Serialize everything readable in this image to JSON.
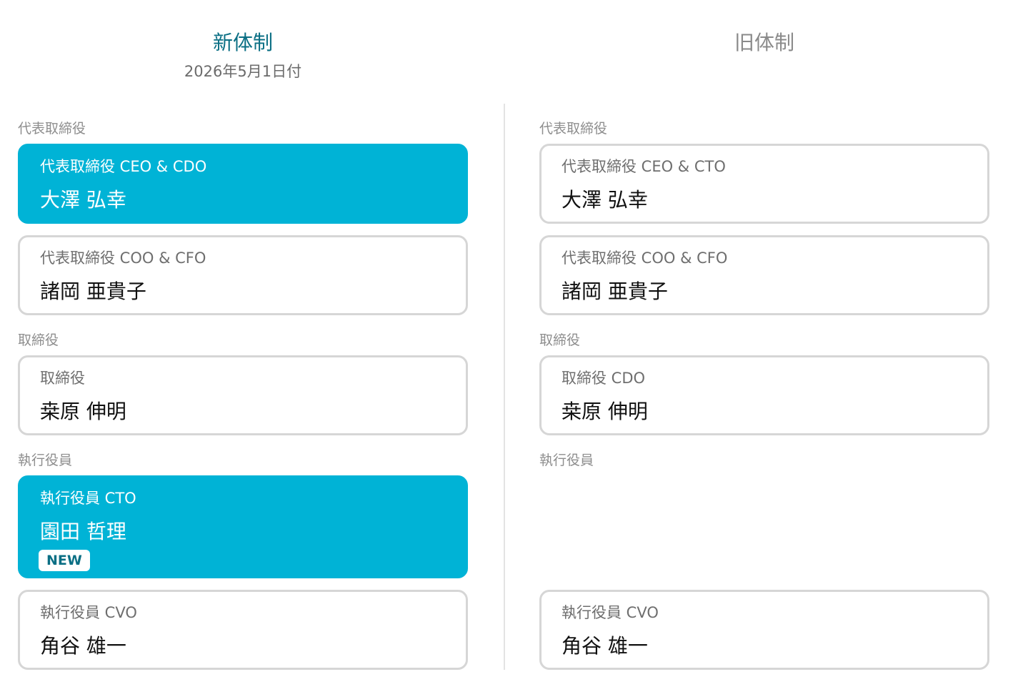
{
  "new_structure": {
    "title": "新体制",
    "date": "2026年5月1日付",
    "sections": {
      "representative_label": "代表取締役",
      "director_label": "取締役",
      "executive_label": "執行役員"
    },
    "cards": [
      {
        "role": "代表取締役 CEO & CDO",
        "name": "大澤 弘幸",
        "highlight": true
      },
      {
        "role": "代表取締役 COO & CFO",
        "name": "諸岡 亜貴子",
        "highlight": false
      },
      {
        "role": "取締役",
        "name": "桒原 伸明",
        "highlight": false
      },
      {
        "role": "執行役員 CTO",
        "name": "園田 哲理",
        "highlight": true,
        "badge": "NEW"
      },
      {
        "role": "執行役員 CVO",
        "name": "角谷 雄一",
        "highlight": false
      }
    ]
  },
  "old_structure": {
    "title": "旧体制",
    "sections": {
      "representative_label": "代表取締役",
      "director_label": "取締役",
      "executive_label": "執行役員"
    },
    "cards": [
      {
        "role": "代表取締役 CEO & CTO",
        "name": "大澤 弘幸",
        "highlight": false
      },
      {
        "role": "代表取締役 COO & CFO",
        "name": "諸岡 亜貴子",
        "highlight": false
      },
      {
        "role": "取締役 CDO",
        "name": "桒原 伸明",
        "highlight": false
      },
      {
        "role": "執行役員 CVO",
        "name": "角谷 雄一",
        "highlight": false
      }
    ]
  },
  "colors": {
    "accent": "#00b3d6",
    "title_accent": "#0b6f84",
    "card_border": "#d6d6d6",
    "label_gray": "#8e8e8e"
  }
}
